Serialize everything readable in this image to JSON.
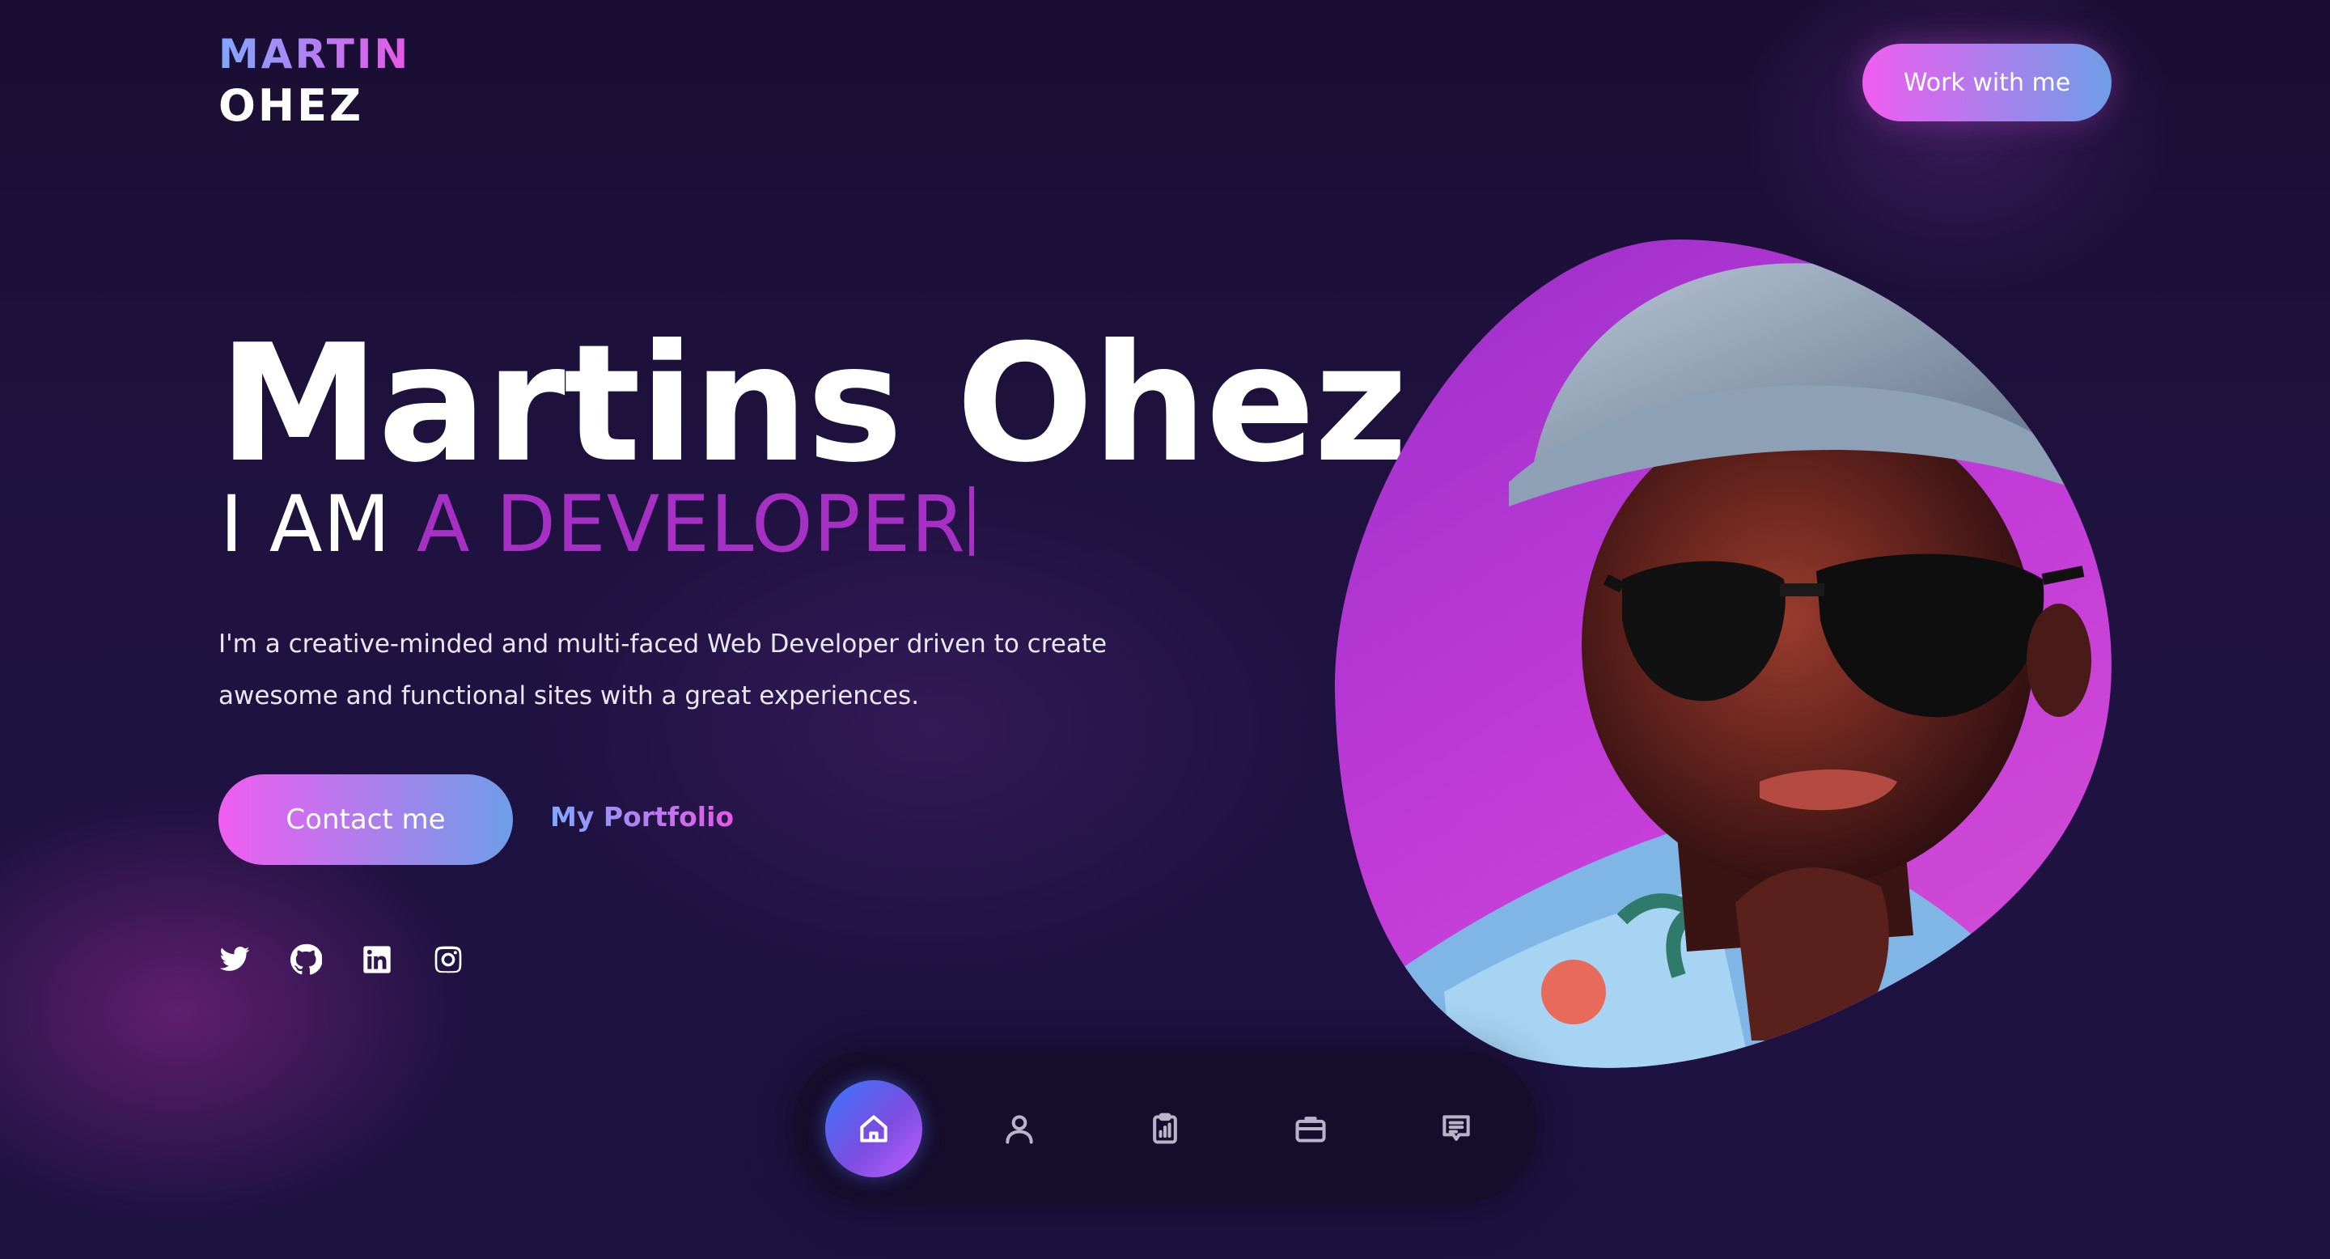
{
  "header": {
    "logo_line1": "MARTIN",
    "logo_line2": "OHEZ",
    "cta_label": "Work with me"
  },
  "hero": {
    "name": "Martins Ohez",
    "role_prefix": "I AM",
    "role_typed": "A DEVELOPER",
    "description_line1": "I'm a creative-minded and multi-faced Web Developer driven to create",
    "description_line2": "awesome and functional sites with a great experiences.",
    "primary_button": "Contact me",
    "secondary_link": "My Portfolio"
  },
  "socials": [
    {
      "icon": "twitter-icon"
    },
    {
      "icon": "github-icon"
    },
    {
      "icon": "linkedin-icon"
    },
    {
      "icon": "instagram-icon"
    }
  ],
  "dock": {
    "active_index": 0,
    "items": [
      {
        "icon": "home-icon"
      },
      {
        "icon": "user-icon"
      },
      {
        "icon": "clipboard-chart-icon"
      },
      {
        "icon": "briefcase-icon"
      },
      {
        "icon": "message-icon"
      }
    ]
  },
  "colors": {
    "accent_pink": "#f05df0",
    "accent_blue": "#6e9de8",
    "accent_purple": "#a630c4",
    "background": "#1c1240"
  }
}
